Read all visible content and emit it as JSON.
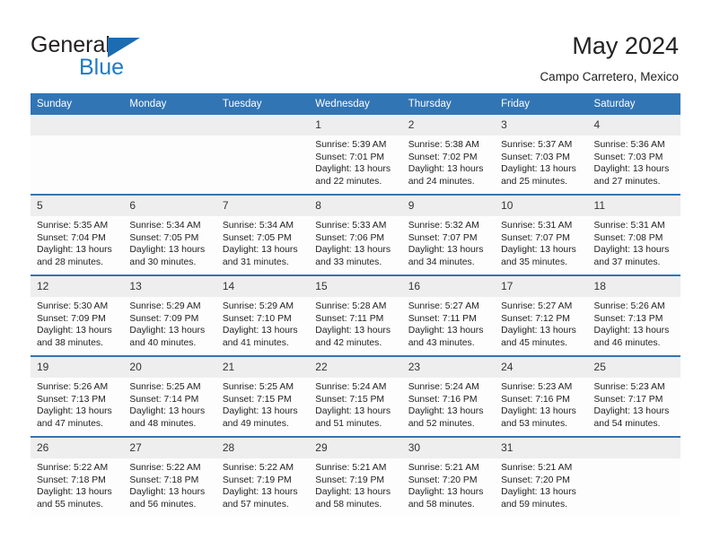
{
  "brand": {
    "name_top": "General",
    "name_bottom": "Blue",
    "color_blue": "#1e7bc8",
    "color_dark": "#231f20"
  },
  "header": {
    "title": "May 2024",
    "subtitle": "Campo Carretero, Mexico",
    "accent_color": "#3275b5"
  },
  "calendar": {
    "weekday_headers": [
      "Sunday",
      "Monday",
      "Tuesday",
      "Wednesday",
      "Thursday",
      "Friday",
      "Saturday"
    ],
    "weeks": [
      [
        {
          "day": "",
          "sunrise": "",
          "sunset": "",
          "daylight": "",
          "empty": true
        },
        {
          "day": "",
          "sunrise": "",
          "sunset": "",
          "daylight": "",
          "empty": true
        },
        {
          "day": "",
          "sunrise": "",
          "sunset": "",
          "daylight": "",
          "empty": true
        },
        {
          "day": "1",
          "sunrise": "Sunrise: 5:39 AM",
          "sunset": "Sunset: 7:01 PM",
          "daylight": "Daylight: 13 hours and 22 minutes."
        },
        {
          "day": "2",
          "sunrise": "Sunrise: 5:38 AM",
          "sunset": "Sunset: 7:02 PM",
          "daylight": "Daylight: 13 hours and 24 minutes."
        },
        {
          "day": "3",
          "sunrise": "Sunrise: 5:37 AM",
          "sunset": "Sunset: 7:03 PM",
          "daylight": "Daylight: 13 hours and 25 minutes."
        },
        {
          "day": "4",
          "sunrise": "Sunrise: 5:36 AM",
          "sunset": "Sunset: 7:03 PM",
          "daylight": "Daylight: 13 hours and 27 minutes."
        }
      ],
      [
        {
          "day": "5",
          "sunrise": "Sunrise: 5:35 AM",
          "sunset": "Sunset: 7:04 PM",
          "daylight": "Daylight: 13 hours and 28 minutes."
        },
        {
          "day": "6",
          "sunrise": "Sunrise: 5:34 AM",
          "sunset": "Sunset: 7:05 PM",
          "daylight": "Daylight: 13 hours and 30 minutes."
        },
        {
          "day": "7",
          "sunrise": "Sunrise: 5:34 AM",
          "sunset": "Sunset: 7:05 PM",
          "daylight": "Daylight: 13 hours and 31 minutes."
        },
        {
          "day": "8",
          "sunrise": "Sunrise: 5:33 AM",
          "sunset": "Sunset: 7:06 PM",
          "daylight": "Daylight: 13 hours and 33 minutes."
        },
        {
          "day": "9",
          "sunrise": "Sunrise: 5:32 AM",
          "sunset": "Sunset: 7:07 PM",
          "daylight": "Daylight: 13 hours and 34 minutes."
        },
        {
          "day": "10",
          "sunrise": "Sunrise: 5:31 AM",
          "sunset": "Sunset: 7:07 PM",
          "daylight": "Daylight: 13 hours and 35 minutes."
        },
        {
          "day": "11",
          "sunrise": "Sunrise: 5:31 AM",
          "sunset": "Sunset: 7:08 PM",
          "daylight": "Daylight: 13 hours and 37 minutes."
        }
      ],
      [
        {
          "day": "12",
          "sunrise": "Sunrise: 5:30 AM",
          "sunset": "Sunset: 7:09 PM",
          "daylight": "Daylight: 13 hours and 38 minutes."
        },
        {
          "day": "13",
          "sunrise": "Sunrise: 5:29 AM",
          "sunset": "Sunset: 7:09 PM",
          "daylight": "Daylight: 13 hours and 40 minutes."
        },
        {
          "day": "14",
          "sunrise": "Sunrise: 5:29 AM",
          "sunset": "Sunset: 7:10 PM",
          "daylight": "Daylight: 13 hours and 41 minutes."
        },
        {
          "day": "15",
          "sunrise": "Sunrise: 5:28 AM",
          "sunset": "Sunset: 7:11 PM",
          "daylight": "Daylight: 13 hours and 42 minutes."
        },
        {
          "day": "16",
          "sunrise": "Sunrise: 5:27 AM",
          "sunset": "Sunset: 7:11 PM",
          "daylight": "Daylight: 13 hours and 43 minutes."
        },
        {
          "day": "17",
          "sunrise": "Sunrise: 5:27 AM",
          "sunset": "Sunset: 7:12 PM",
          "daylight": "Daylight: 13 hours and 45 minutes."
        },
        {
          "day": "18",
          "sunrise": "Sunrise: 5:26 AM",
          "sunset": "Sunset: 7:13 PM",
          "daylight": "Daylight: 13 hours and 46 minutes."
        }
      ],
      [
        {
          "day": "19",
          "sunrise": "Sunrise: 5:26 AM",
          "sunset": "Sunset: 7:13 PM",
          "daylight": "Daylight: 13 hours and 47 minutes."
        },
        {
          "day": "20",
          "sunrise": "Sunrise: 5:25 AM",
          "sunset": "Sunset: 7:14 PM",
          "daylight": "Daylight: 13 hours and 48 minutes."
        },
        {
          "day": "21",
          "sunrise": "Sunrise: 5:25 AM",
          "sunset": "Sunset: 7:15 PM",
          "daylight": "Daylight: 13 hours and 49 minutes."
        },
        {
          "day": "22",
          "sunrise": "Sunrise: 5:24 AM",
          "sunset": "Sunset: 7:15 PM",
          "daylight": "Daylight: 13 hours and 51 minutes."
        },
        {
          "day": "23",
          "sunrise": "Sunrise: 5:24 AM",
          "sunset": "Sunset: 7:16 PM",
          "daylight": "Daylight: 13 hours and 52 minutes."
        },
        {
          "day": "24",
          "sunrise": "Sunrise: 5:23 AM",
          "sunset": "Sunset: 7:16 PM",
          "daylight": "Daylight: 13 hours and 53 minutes."
        },
        {
          "day": "25",
          "sunrise": "Sunrise: 5:23 AM",
          "sunset": "Sunset: 7:17 PM",
          "daylight": "Daylight: 13 hours and 54 minutes."
        }
      ],
      [
        {
          "day": "26",
          "sunrise": "Sunrise: 5:22 AM",
          "sunset": "Sunset: 7:18 PM",
          "daylight": "Daylight: 13 hours and 55 minutes."
        },
        {
          "day": "27",
          "sunrise": "Sunrise: 5:22 AM",
          "sunset": "Sunset: 7:18 PM",
          "daylight": "Daylight: 13 hours and 56 minutes."
        },
        {
          "day": "28",
          "sunrise": "Sunrise: 5:22 AM",
          "sunset": "Sunset: 7:19 PM",
          "daylight": "Daylight: 13 hours and 57 minutes."
        },
        {
          "day": "29",
          "sunrise": "Sunrise: 5:21 AM",
          "sunset": "Sunset: 7:19 PM",
          "daylight": "Daylight: 13 hours and 58 minutes."
        },
        {
          "day": "30",
          "sunrise": "Sunrise: 5:21 AM",
          "sunset": "Sunset: 7:20 PM",
          "daylight": "Daylight: 13 hours and 58 minutes."
        },
        {
          "day": "31",
          "sunrise": "Sunrise: 5:21 AM",
          "sunset": "Sunset: 7:20 PM",
          "daylight": "Daylight: 13 hours and 59 minutes."
        },
        {
          "day": "",
          "sunrise": "",
          "sunset": "",
          "daylight": "",
          "empty": true
        }
      ]
    ]
  }
}
